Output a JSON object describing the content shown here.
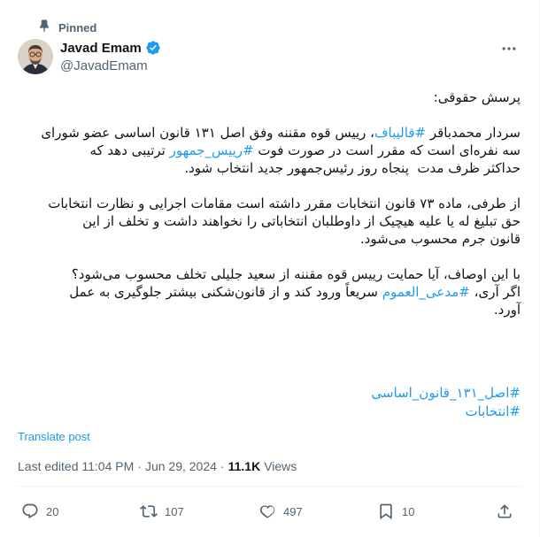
{
  "pinned": {
    "label": "Pinned",
    "icon": "pin-icon"
  },
  "author": {
    "display_name": "Javad Emam",
    "handle": "@JavadEmam",
    "verified": true,
    "verified_color": "#1d9bf0"
  },
  "tweet": {
    "paragraphs": [
      [
        [
          {
            "text": "پرسش حقوقی:"
          }
        ]
      ],
      [
        [
          {
            "text": "سردار محمدباقر "
          },
          {
            "text": "#قالیباف",
            "hashtag": true
          },
          {
            "text": "، رییس قوه مقننه وفق اصل ۱۳۱ قانون اساسی عضو شورای"
          }
        ],
        [
          {
            "text": "سه نفره‌ای است که مقرر است در صورت فوت "
          },
          {
            "text": "#رییس_جمهور",
            "hashtag": true
          },
          {
            "text": " ترتیبی دهد که"
          }
        ],
        [
          {
            "text": "حداکثر ظرف مدت  پنجاه روز رئیس‌جمهور جدید انتخاب شود."
          }
        ]
      ],
      [
        [
          {
            "text": "از طرفی، ماده ۷۳ قانون انتخابات مقرر داشته است مقامات اجرایی و نظارت انتخابات"
          }
        ],
        [
          {
            "text": "حق تبلیغ له یا علیه هیچیک از داوطلبان انتخاباتی را نخواهند داشت و تخلف از این"
          }
        ],
        [
          {
            "text": "قانون جرم محسوب می‌شود."
          }
        ]
      ],
      [
        [
          {
            "text": "با این اوصاف، آیا حمایت رییس قوه مقننه از سعید جلیلی تخلف محسوب می‌شود؟"
          }
        ],
        [
          {
            "text": "اگر آری، "
          },
          {
            "text": "#مدعی_العموم",
            "hashtag": true
          },
          {
            "text": " سریعاً ورود کند و از قانون‌شکنی بیشتر جلوگیری به عمل"
          }
        ],
        [
          {
            "text": "آورد."
          }
        ]
      ]
    ],
    "hashtags": [
      "#اصل_۱۳۱_قانون_اساسی",
      "#انتخابات"
    ],
    "translate_label": "Translate post"
  },
  "meta": {
    "edited_label": "Last edited 11:04 PM",
    "separator": "·",
    "date": "Jun 29, 2024",
    "views_count": "11.1K",
    "views_label": "Views"
  },
  "actions": {
    "replies": "20",
    "reposts": "107",
    "likes": "497",
    "bookmarks": "10"
  },
  "colors": {
    "accent": "#1d9bf0",
    "text_primary": "#0f1419",
    "text_secondary": "#536471",
    "divider": "#eff3f4"
  }
}
